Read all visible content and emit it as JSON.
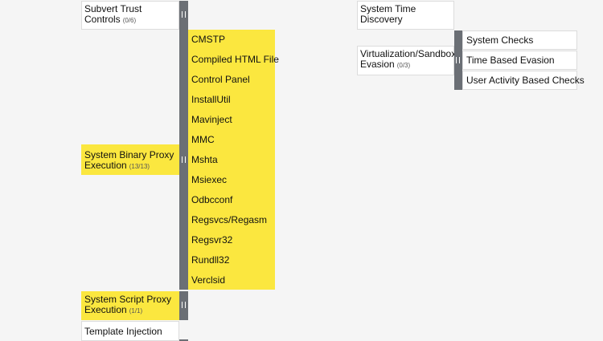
{
  "left": {
    "subvert": {
      "label": "Subvert Trust Controls",
      "count": "(0/6)"
    },
    "proxy": {
      "label": "System Binary Proxy Execution",
      "count": "(13/13)",
      "subs": [
        "CMSTP",
        "Compiled HTML File",
        "Control Panel",
        "InstallUtil",
        "Mavinject",
        "MMC",
        "Mshta",
        "Msiexec",
        "Odbcconf",
        "Regsvcs/Regasm",
        "Regsvr32",
        "Rundll32",
        "Verclsid"
      ]
    },
    "script_proxy": {
      "label": "System Script Proxy Execution",
      "count": "(1/1)"
    },
    "template": {
      "label": "Template Injection"
    }
  },
  "right": {
    "time_discovery": {
      "label": "System Time Discovery"
    },
    "virt": {
      "label": "Virtualization/Sandbox Evasion",
      "count": "(0/3)",
      "subs": [
        "System Checks",
        "Time Based Evasion",
        "User Activity Based Checks"
      ]
    }
  },
  "colors": {
    "highlight": "#fbe73f",
    "handle": "#6b6f75",
    "border": "#dcdcdc",
    "background": "#f5f5f5"
  }
}
